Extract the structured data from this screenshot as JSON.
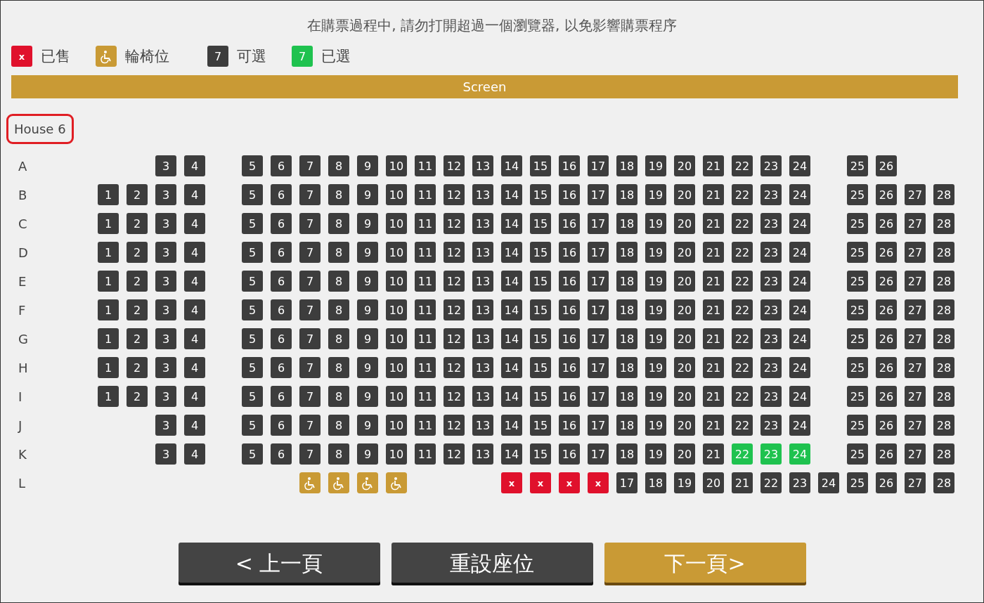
{
  "notice": "在購票過程中, 請勿打開超過一個瀏覽器, 以免影響購票程序",
  "legend": [
    {
      "kind": "sold",
      "sample": "x",
      "label": "已售"
    },
    {
      "kind": "wheelchair",
      "label": "輪椅位"
    },
    {
      "kind": "available",
      "sample": "7",
      "label": "可選"
    },
    {
      "kind": "selected",
      "sample": "7",
      "label": "已選"
    }
  ],
  "screen": "Screen",
  "house": "House 6",
  "rows": [
    {
      "label": "A",
      "slots": [
        {
          "kind": "blank"
        },
        {
          "kind": "blank"
        },
        {
          "kind": "seat",
          "label": "3",
          "selected": false
        },
        {
          "kind": "seat",
          "label": "4",
          "selected": false
        },
        {
          "kind": "blank"
        },
        {
          "kind": "seat",
          "label": "5",
          "selected": false
        },
        {
          "kind": "seat",
          "label": "6",
          "selected": false
        },
        {
          "kind": "seat",
          "label": "7",
          "selected": false
        },
        {
          "kind": "seat",
          "label": "8",
          "selected": false
        },
        {
          "kind": "seat",
          "label": "9",
          "selected": false
        },
        {
          "kind": "seat",
          "label": "10",
          "selected": false
        },
        {
          "kind": "seat",
          "label": "11",
          "selected": false
        },
        {
          "kind": "seat",
          "label": "12",
          "selected": false
        },
        {
          "kind": "seat",
          "label": "13",
          "selected": false
        },
        {
          "kind": "seat",
          "label": "14",
          "selected": false
        },
        {
          "kind": "seat",
          "label": "15",
          "selected": false
        },
        {
          "kind": "seat",
          "label": "16",
          "selected": false
        },
        {
          "kind": "seat",
          "label": "17",
          "selected": false
        },
        {
          "kind": "seat",
          "label": "18",
          "selected": false
        },
        {
          "kind": "seat",
          "label": "19",
          "selected": false
        },
        {
          "kind": "seat",
          "label": "20",
          "selected": false
        },
        {
          "kind": "seat",
          "label": "21",
          "selected": false
        },
        {
          "kind": "seat",
          "label": "22",
          "selected": false
        },
        {
          "kind": "seat",
          "label": "23",
          "selected": false
        },
        {
          "kind": "seat",
          "label": "24",
          "selected": false
        },
        {
          "kind": "blank"
        },
        {
          "kind": "seat",
          "label": "25",
          "selected": false
        },
        {
          "kind": "seat",
          "label": "26",
          "selected": false
        },
        {
          "kind": "blank"
        },
        {
          "kind": "blank"
        }
      ]
    },
    {
      "label": "B",
      "slots": [
        {
          "kind": "seat",
          "label": "1",
          "selected": false
        },
        {
          "kind": "seat",
          "label": "2",
          "selected": false
        },
        {
          "kind": "seat",
          "label": "3",
          "selected": false
        },
        {
          "kind": "seat",
          "label": "4",
          "selected": false
        },
        {
          "kind": "blank"
        },
        {
          "kind": "seat",
          "label": "5",
          "selected": false
        },
        {
          "kind": "seat",
          "label": "6",
          "selected": false
        },
        {
          "kind": "seat",
          "label": "7",
          "selected": false
        },
        {
          "kind": "seat",
          "label": "8",
          "selected": false
        },
        {
          "kind": "seat",
          "label": "9",
          "selected": false
        },
        {
          "kind": "seat",
          "label": "10",
          "selected": false
        },
        {
          "kind": "seat",
          "label": "11",
          "selected": false
        },
        {
          "kind": "seat",
          "label": "12",
          "selected": false
        },
        {
          "kind": "seat",
          "label": "13",
          "selected": false
        },
        {
          "kind": "seat",
          "label": "14",
          "selected": false
        },
        {
          "kind": "seat",
          "label": "15",
          "selected": false
        },
        {
          "kind": "seat",
          "label": "16",
          "selected": false
        },
        {
          "kind": "seat",
          "label": "17",
          "selected": false
        },
        {
          "kind": "seat",
          "label": "18",
          "selected": false
        },
        {
          "kind": "seat",
          "label": "19",
          "selected": false
        },
        {
          "kind": "seat",
          "label": "20",
          "selected": false
        },
        {
          "kind": "seat",
          "label": "21",
          "selected": false
        },
        {
          "kind": "seat",
          "label": "22",
          "selected": false
        },
        {
          "kind": "seat",
          "label": "23",
          "selected": false
        },
        {
          "kind": "seat",
          "label": "24",
          "selected": false
        },
        {
          "kind": "blank"
        },
        {
          "kind": "seat",
          "label": "25",
          "selected": false
        },
        {
          "kind": "seat",
          "label": "26",
          "selected": false
        },
        {
          "kind": "seat",
          "label": "27",
          "selected": false
        },
        {
          "kind": "seat",
          "label": "28",
          "selected": false
        }
      ]
    },
    {
      "label": "C",
      "slots": [
        {
          "kind": "seat",
          "label": "1",
          "selected": false
        },
        {
          "kind": "seat",
          "label": "2",
          "selected": false
        },
        {
          "kind": "seat",
          "label": "3",
          "selected": false
        },
        {
          "kind": "seat",
          "label": "4",
          "selected": false
        },
        {
          "kind": "blank"
        },
        {
          "kind": "seat",
          "label": "5",
          "selected": false
        },
        {
          "kind": "seat",
          "label": "6",
          "selected": false
        },
        {
          "kind": "seat",
          "label": "7",
          "selected": false
        },
        {
          "kind": "seat",
          "label": "8",
          "selected": false
        },
        {
          "kind": "seat",
          "label": "9",
          "selected": false
        },
        {
          "kind": "seat",
          "label": "10",
          "selected": false
        },
        {
          "kind": "seat",
          "label": "11",
          "selected": false
        },
        {
          "kind": "seat",
          "label": "12",
          "selected": false
        },
        {
          "kind": "seat",
          "label": "13",
          "selected": false
        },
        {
          "kind": "seat",
          "label": "14",
          "selected": false
        },
        {
          "kind": "seat",
          "label": "15",
          "selected": false
        },
        {
          "kind": "seat",
          "label": "16",
          "selected": false
        },
        {
          "kind": "seat",
          "label": "17",
          "selected": false
        },
        {
          "kind": "seat",
          "label": "18",
          "selected": false
        },
        {
          "kind": "seat",
          "label": "19",
          "selected": false
        },
        {
          "kind": "seat",
          "label": "20",
          "selected": false
        },
        {
          "kind": "seat",
          "label": "21",
          "selected": false
        },
        {
          "kind": "seat",
          "label": "22",
          "selected": false
        },
        {
          "kind": "seat",
          "label": "23",
          "selected": false
        },
        {
          "kind": "seat",
          "label": "24",
          "selected": false
        },
        {
          "kind": "blank"
        },
        {
          "kind": "seat",
          "label": "25",
          "selected": false
        },
        {
          "kind": "seat",
          "label": "26",
          "selected": false
        },
        {
          "kind": "seat",
          "label": "27",
          "selected": false
        },
        {
          "kind": "seat",
          "label": "28",
          "selected": false
        }
      ]
    },
    {
      "label": "D",
      "slots": [
        {
          "kind": "seat",
          "label": "1",
          "selected": false
        },
        {
          "kind": "seat",
          "label": "2",
          "selected": false
        },
        {
          "kind": "seat",
          "label": "3",
          "selected": false
        },
        {
          "kind": "seat",
          "label": "4",
          "selected": false
        },
        {
          "kind": "blank"
        },
        {
          "kind": "seat",
          "label": "5",
          "selected": false
        },
        {
          "kind": "seat",
          "label": "6",
          "selected": false
        },
        {
          "kind": "seat",
          "label": "7",
          "selected": false
        },
        {
          "kind": "seat",
          "label": "8",
          "selected": false
        },
        {
          "kind": "seat",
          "label": "9",
          "selected": false
        },
        {
          "kind": "seat",
          "label": "10",
          "selected": false
        },
        {
          "kind": "seat",
          "label": "11",
          "selected": false
        },
        {
          "kind": "seat",
          "label": "12",
          "selected": false
        },
        {
          "kind": "seat",
          "label": "13",
          "selected": false
        },
        {
          "kind": "seat",
          "label": "14",
          "selected": false
        },
        {
          "kind": "seat",
          "label": "15",
          "selected": false
        },
        {
          "kind": "seat",
          "label": "16",
          "selected": false
        },
        {
          "kind": "seat",
          "label": "17",
          "selected": false
        },
        {
          "kind": "seat",
          "label": "18",
          "selected": false
        },
        {
          "kind": "seat",
          "label": "19",
          "selected": false
        },
        {
          "kind": "seat",
          "label": "20",
          "selected": false
        },
        {
          "kind": "seat",
          "label": "21",
          "selected": false
        },
        {
          "kind": "seat",
          "label": "22",
          "selected": false
        },
        {
          "kind": "seat",
          "label": "23",
          "selected": false
        },
        {
          "kind": "seat",
          "label": "24",
          "selected": false
        },
        {
          "kind": "blank"
        },
        {
          "kind": "seat",
          "label": "25",
          "selected": false
        },
        {
          "kind": "seat",
          "label": "26",
          "selected": false
        },
        {
          "kind": "seat",
          "label": "27",
          "selected": false
        },
        {
          "kind": "seat",
          "label": "28",
          "selected": false
        }
      ]
    },
    {
      "label": "E",
      "slots": [
        {
          "kind": "seat",
          "label": "1",
          "selected": false
        },
        {
          "kind": "seat",
          "label": "2",
          "selected": false
        },
        {
          "kind": "seat",
          "label": "3",
          "selected": false
        },
        {
          "kind": "seat",
          "label": "4",
          "selected": false
        },
        {
          "kind": "blank"
        },
        {
          "kind": "seat",
          "label": "5",
          "selected": false
        },
        {
          "kind": "seat",
          "label": "6",
          "selected": false
        },
        {
          "kind": "seat",
          "label": "7",
          "selected": false
        },
        {
          "kind": "seat",
          "label": "8",
          "selected": false
        },
        {
          "kind": "seat",
          "label": "9",
          "selected": false
        },
        {
          "kind": "seat",
          "label": "10",
          "selected": false
        },
        {
          "kind": "seat",
          "label": "11",
          "selected": false
        },
        {
          "kind": "seat",
          "label": "12",
          "selected": false
        },
        {
          "kind": "seat",
          "label": "13",
          "selected": false
        },
        {
          "kind": "seat",
          "label": "14",
          "selected": false
        },
        {
          "kind": "seat",
          "label": "15",
          "selected": false
        },
        {
          "kind": "seat",
          "label": "16",
          "selected": false
        },
        {
          "kind": "seat",
          "label": "17",
          "selected": false
        },
        {
          "kind": "seat",
          "label": "18",
          "selected": false
        },
        {
          "kind": "seat",
          "label": "19",
          "selected": false
        },
        {
          "kind": "seat",
          "label": "20",
          "selected": false
        },
        {
          "kind": "seat",
          "label": "21",
          "selected": false
        },
        {
          "kind": "seat",
          "label": "22",
          "selected": false
        },
        {
          "kind": "seat",
          "label": "23",
          "selected": false
        },
        {
          "kind": "seat",
          "label": "24",
          "selected": false
        },
        {
          "kind": "blank"
        },
        {
          "kind": "seat",
          "label": "25",
          "selected": false
        },
        {
          "kind": "seat",
          "label": "26",
          "selected": false
        },
        {
          "kind": "seat",
          "label": "27",
          "selected": false
        },
        {
          "kind": "seat",
          "label": "28",
          "selected": false
        }
      ]
    },
    {
      "label": "F",
      "slots": [
        {
          "kind": "seat",
          "label": "1",
          "selected": false
        },
        {
          "kind": "seat",
          "label": "2",
          "selected": false
        },
        {
          "kind": "seat",
          "label": "3",
          "selected": false
        },
        {
          "kind": "seat",
          "label": "4",
          "selected": false
        },
        {
          "kind": "blank"
        },
        {
          "kind": "seat",
          "label": "5",
          "selected": false
        },
        {
          "kind": "seat",
          "label": "6",
          "selected": false
        },
        {
          "kind": "seat",
          "label": "7",
          "selected": false
        },
        {
          "kind": "seat",
          "label": "8",
          "selected": false
        },
        {
          "kind": "seat",
          "label": "9",
          "selected": false
        },
        {
          "kind": "seat",
          "label": "10",
          "selected": false
        },
        {
          "kind": "seat",
          "label": "11",
          "selected": false
        },
        {
          "kind": "seat",
          "label": "12",
          "selected": false
        },
        {
          "kind": "seat",
          "label": "13",
          "selected": false
        },
        {
          "kind": "seat",
          "label": "14",
          "selected": false
        },
        {
          "kind": "seat",
          "label": "15",
          "selected": false
        },
        {
          "kind": "seat",
          "label": "16",
          "selected": false
        },
        {
          "kind": "seat",
          "label": "17",
          "selected": false
        },
        {
          "kind": "seat",
          "label": "18",
          "selected": false
        },
        {
          "kind": "seat",
          "label": "19",
          "selected": false
        },
        {
          "kind": "seat",
          "label": "20",
          "selected": false
        },
        {
          "kind": "seat",
          "label": "21",
          "selected": false
        },
        {
          "kind": "seat",
          "label": "22",
          "selected": false
        },
        {
          "kind": "seat",
          "label": "23",
          "selected": false
        },
        {
          "kind": "seat",
          "label": "24",
          "selected": false
        },
        {
          "kind": "blank"
        },
        {
          "kind": "seat",
          "label": "25",
          "selected": false
        },
        {
          "kind": "seat",
          "label": "26",
          "selected": false
        },
        {
          "kind": "seat",
          "label": "27",
          "selected": false
        },
        {
          "kind": "seat",
          "label": "28",
          "selected": false
        }
      ]
    },
    {
      "label": "G",
      "slots": [
        {
          "kind": "seat",
          "label": "1",
          "selected": false
        },
        {
          "kind": "seat",
          "label": "2",
          "selected": false
        },
        {
          "kind": "seat",
          "label": "3",
          "selected": false
        },
        {
          "kind": "seat",
          "label": "4",
          "selected": false
        },
        {
          "kind": "blank"
        },
        {
          "kind": "seat",
          "label": "5",
          "selected": false
        },
        {
          "kind": "seat",
          "label": "6",
          "selected": false
        },
        {
          "kind": "seat",
          "label": "7",
          "selected": false
        },
        {
          "kind": "seat",
          "label": "8",
          "selected": false
        },
        {
          "kind": "seat",
          "label": "9",
          "selected": false
        },
        {
          "kind": "seat",
          "label": "10",
          "selected": false
        },
        {
          "kind": "seat",
          "label": "11",
          "selected": false
        },
        {
          "kind": "seat",
          "label": "12",
          "selected": false
        },
        {
          "kind": "seat",
          "label": "13",
          "selected": false
        },
        {
          "kind": "seat",
          "label": "14",
          "selected": false
        },
        {
          "kind": "seat",
          "label": "15",
          "selected": false
        },
        {
          "kind": "seat",
          "label": "16",
          "selected": false
        },
        {
          "kind": "seat",
          "label": "17",
          "selected": false
        },
        {
          "kind": "seat",
          "label": "18",
          "selected": false
        },
        {
          "kind": "seat",
          "label": "19",
          "selected": false
        },
        {
          "kind": "seat",
          "label": "20",
          "selected": false
        },
        {
          "kind": "seat",
          "label": "21",
          "selected": false
        },
        {
          "kind": "seat",
          "label": "22",
          "selected": false
        },
        {
          "kind": "seat",
          "label": "23",
          "selected": false
        },
        {
          "kind": "seat",
          "label": "24",
          "selected": false
        },
        {
          "kind": "blank"
        },
        {
          "kind": "seat",
          "label": "25",
          "selected": false
        },
        {
          "kind": "seat",
          "label": "26",
          "selected": false
        },
        {
          "kind": "seat",
          "label": "27",
          "selected": false
        },
        {
          "kind": "seat",
          "label": "28",
          "selected": false
        }
      ]
    },
    {
      "label": "H",
      "slots": [
        {
          "kind": "seat",
          "label": "1",
          "selected": false
        },
        {
          "kind": "seat",
          "label": "2",
          "selected": false
        },
        {
          "kind": "seat",
          "label": "3",
          "selected": false
        },
        {
          "kind": "seat",
          "label": "4",
          "selected": false
        },
        {
          "kind": "blank"
        },
        {
          "kind": "seat",
          "label": "5",
          "selected": false
        },
        {
          "kind": "seat",
          "label": "6",
          "selected": false
        },
        {
          "kind": "seat",
          "label": "7",
          "selected": false
        },
        {
          "kind": "seat",
          "label": "8",
          "selected": false
        },
        {
          "kind": "seat",
          "label": "9",
          "selected": false
        },
        {
          "kind": "seat",
          "label": "10",
          "selected": false
        },
        {
          "kind": "seat",
          "label": "11",
          "selected": false
        },
        {
          "kind": "seat",
          "label": "12",
          "selected": false
        },
        {
          "kind": "seat",
          "label": "13",
          "selected": false
        },
        {
          "kind": "seat",
          "label": "14",
          "selected": false
        },
        {
          "kind": "seat",
          "label": "15",
          "selected": false
        },
        {
          "kind": "seat",
          "label": "16",
          "selected": false
        },
        {
          "kind": "seat",
          "label": "17",
          "selected": false
        },
        {
          "kind": "seat",
          "label": "18",
          "selected": false
        },
        {
          "kind": "seat",
          "label": "19",
          "selected": false
        },
        {
          "kind": "seat",
          "label": "20",
          "selected": false
        },
        {
          "kind": "seat",
          "label": "21",
          "selected": false
        },
        {
          "kind": "seat",
          "label": "22",
          "selected": false
        },
        {
          "kind": "seat",
          "label": "23",
          "selected": false
        },
        {
          "kind": "seat",
          "label": "24",
          "selected": false
        },
        {
          "kind": "blank"
        },
        {
          "kind": "seat",
          "label": "25",
          "selected": false
        },
        {
          "kind": "seat",
          "label": "26",
          "selected": false
        },
        {
          "kind": "seat",
          "label": "27",
          "selected": false
        },
        {
          "kind": "seat",
          "label": "28",
          "selected": false
        }
      ]
    },
    {
      "label": "I",
      "slots": [
        {
          "kind": "seat",
          "label": "1",
          "selected": false
        },
        {
          "kind": "seat",
          "label": "2",
          "selected": false
        },
        {
          "kind": "seat",
          "label": "3",
          "selected": false
        },
        {
          "kind": "seat",
          "label": "4",
          "selected": false
        },
        {
          "kind": "blank"
        },
        {
          "kind": "seat",
          "label": "5",
          "selected": false
        },
        {
          "kind": "seat",
          "label": "6",
          "selected": false
        },
        {
          "kind": "seat",
          "label": "7",
          "selected": false
        },
        {
          "kind": "seat",
          "label": "8",
          "selected": false
        },
        {
          "kind": "seat",
          "label": "9",
          "selected": false
        },
        {
          "kind": "seat",
          "label": "10",
          "selected": false
        },
        {
          "kind": "seat",
          "label": "11",
          "selected": false
        },
        {
          "kind": "seat",
          "label": "12",
          "selected": false
        },
        {
          "kind": "seat",
          "label": "13",
          "selected": false
        },
        {
          "kind": "seat",
          "label": "14",
          "selected": false
        },
        {
          "kind": "seat",
          "label": "15",
          "selected": false
        },
        {
          "kind": "seat",
          "label": "16",
          "selected": false
        },
        {
          "kind": "seat",
          "label": "17",
          "selected": false
        },
        {
          "kind": "seat",
          "label": "18",
          "selected": false
        },
        {
          "kind": "seat",
          "label": "19",
          "selected": false
        },
        {
          "kind": "seat",
          "label": "20",
          "selected": false
        },
        {
          "kind": "seat",
          "label": "21",
          "selected": false
        },
        {
          "kind": "seat",
          "label": "22",
          "selected": false
        },
        {
          "kind": "seat",
          "label": "23",
          "selected": false
        },
        {
          "kind": "seat",
          "label": "24",
          "selected": false
        },
        {
          "kind": "blank"
        },
        {
          "kind": "seat",
          "label": "25",
          "selected": false
        },
        {
          "kind": "seat",
          "label": "26",
          "selected": false
        },
        {
          "kind": "seat",
          "label": "27",
          "selected": false
        },
        {
          "kind": "seat",
          "label": "28",
          "selected": false
        }
      ]
    },
    {
      "label": "J",
      "slots": [
        {
          "kind": "blank"
        },
        {
          "kind": "blank"
        },
        {
          "kind": "seat",
          "label": "3",
          "selected": false
        },
        {
          "kind": "seat",
          "label": "4",
          "selected": false
        },
        {
          "kind": "blank"
        },
        {
          "kind": "seat",
          "label": "5",
          "selected": false
        },
        {
          "kind": "seat",
          "label": "6",
          "selected": false
        },
        {
          "kind": "seat",
          "label": "7",
          "selected": false
        },
        {
          "kind": "seat",
          "label": "8",
          "selected": false
        },
        {
          "kind": "seat",
          "label": "9",
          "selected": false
        },
        {
          "kind": "seat",
          "label": "10",
          "selected": false
        },
        {
          "kind": "seat",
          "label": "11",
          "selected": false
        },
        {
          "kind": "seat",
          "label": "12",
          "selected": false
        },
        {
          "kind": "seat",
          "label": "13",
          "selected": false
        },
        {
          "kind": "seat",
          "label": "14",
          "selected": false
        },
        {
          "kind": "seat",
          "label": "15",
          "selected": false
        },
        {
          "kind": "seat",
          "label": "16",
          "selected": false
        },
        {
          "kind": "seat",
          "label": "17",
          "selected": false
        },
        {
          "kind": "seat",
          "label": "18",
          "selected": false
        },
        {
          "kind": "seat",
          "label": "19",
          "selected": false
        },
        {
          "kind": "seat",
          "label": "20",
          "selected": false
        },
        {
          "kind": "seat",
          "label": "21",
          "selected": false
        },
        {
          "kind": "seat",
          "label": "22",
          "selected": false
        },
        {
          "kind": "seat",
          "label": "23",
          "selected": false
        },
        {
          "kind": "seat",
          "label": "24",
          "selected": false
        },
        {
          "kind": "blank"
        },
        {
          "kind": "seat",
          "label": "25",
          "selected": false
        },
        {
          "kind": "seat",
          "label": "26",
          "selected": false
        },
        {
          "kind": "seat",
          "label": "27",
          "selected": false
        },
        {
          "kind": "seat",
          "label": "28",
          "selected": false
        }
      ]
    },
    {
      "label": "K",
      "slots": [
        {
          "kind": "blank"
        },
        {
          "kind": "blank"
        },
        {
          "kind": "seat",
          "label": "3",
          "selected": false
        },
        {
          "kind": "seat",
          "label": "4",
          "selected": false
        },
        {
          "kind": "blank"
        },
        {
          "kind": "seat",
          "label": "5",
          "selected": false
        },
        {
          "kind": "seat",
          "label": "6",
          "selected": false
        },
        {
          "kind": "seat",
          "label": "7",
          "selected": false
        },
        {
          "kind": "seat",
          "label": "8",
          "selected": false
        },
        {
          "kind": "seat",
          "label": "9",
          "selected": false
        },
        {
          "kind": "seat",
          "label": "10",
          "selected": false
        },
        {
          "kind": "seat",
          "label": "11",
          "selected": false
        },
        {
          "kind": "seat",
          "label": "12",
          "selected": false
        },
        {
          "kind": "seat",
          "label": "13",
          "selected": false
        },
        {
          "kind": "seat",
          "label": "14",
          "selected": false
        },
        {
          "kind": "seat",
          "label": "15",
          "selected": false
        },
        {
          "kind": "seat",
          "label": "16",
          "selected": false
        },
        {
          "kind": "seat",
          "label": "17",
          "selected": false
        },
        {
          "kind": "seat",
          "label": "18",
          "selected": false
        },
        {
          "kind": "seat",
          "label": "19",
          "selected": false
        },
        {
          "kind": "seat",
          "label": "20",
          "selected": false
        },
        {
          "kind": "seat",
          "label": "21",
          "selected": false
        },
        {
          "kind": "seat",
          "label": "22",
          "selected": true
        },
        {
          "kind": "seat",
          "label": "23",
          "selected": true
        },
        {
          "kind": "seat",
          "label": "24",
          "selected": true
        },
        {
          "kind": "blank"
        },
        {
          "kind": "seat",
          "label": "25",
          "selected": false
        },
        {
          "kind": "seat",
          "label": "26",
          "selected": false
        },
        {
          "kind": "seat",
          "label": "27",
          "selected": false
        },
        {
          "kind": "seat",
          "label": "28",
          "selected": false
        }
      ]
    },
    {
      "label": "L",
      "slots": [
        {
          "kind": "blank"
        },
        {
          "kind": "blank"
        },
        {
          "kind": "blank"
        },
        {
          "kind": "blank"
        },
        {
          "kind": "blank"
        },
        {
          "kind": "blank"
        },
        {
          "kind": "blank"
        },
        {
          "kind": "wheelchair"
        },
        {
          "kind": "wheelchair"
        },
        {
          "kind": "wheelchair"
        },
        {
          "kind": "wheelchair"
        },
        {
          "kind": "blank"
        },
        {
          "kind": "blank"
        },
        {
          "kind": "blank"
        },
        {
          "kind": "sold",
          "label": "x"
        },
        {
          "kind": "sold",
          "label": "x"
        },
        {
          "kind": "sold",
          "label": "x"
        },
        {
          "kind": "sold",
          "label": "x"
        },
        {
          "kind": "seat",
          "label": "17",
          "selected": false
        },
        {
          "kind": "seat",
          "label": "18",
          "selected": false
        },
        {
          "kind": "seat",
          "label": "19",
          "selected": false
        },
        {
          "kind": "seat",
          "label": "20",
          "selected": false
        },
        {
          "kind": "seat",
          "label": "21",
          "selected": false
        },
        {
          "kind": "seat",
          "label": "22",
          "selected": false
        },
        {
          "kind": "seat",
          "label": "23",
          "selected": false
        },
        {
          "kind": "seat",
          "label": "24",
          "selected": false
        },
        {
          "kind": "seat",
          "label": "25",
          "selected": false
        },
        {
          "kind": "seat",
          "label": "26",
          "selected": false
        },
        {
          "kind": "seat",
          "label": "27",
          "selected": false
        },
        {
          "kind": "seat",
          "label": "28",
          "selected": false
        }
      ]
    }
  ],
  "buttons": [
    {
      "kind": "dark",
      "label": "< 上一頁"
    },
    {
      "kind": "dark",
      "label": "重設座位"
    },
    {
      "kind": "gold",
      "label": "下一頁>"
    }
  ]
}
